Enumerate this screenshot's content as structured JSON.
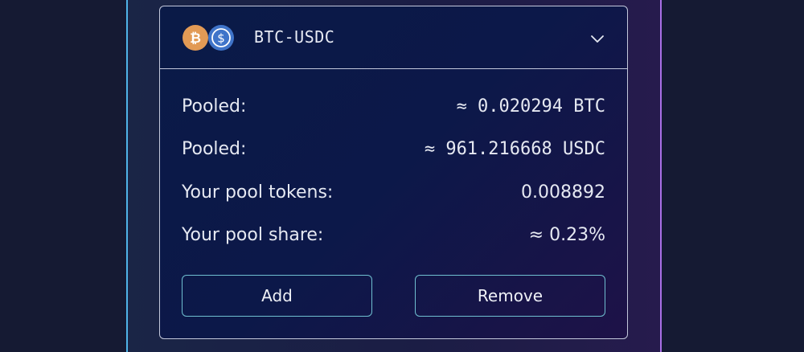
{
  "pool": {
    "pair": "BTC-USDC",
    "icons": {
      "token_a": "bitcoin-icon",
      "token_b": "usdc-icon",
      "expand": "chevron-down-icon"
    },
    "rows": [
      {
        "label": "Pooled:",
        "value": "≈ 0.020294 BTC"
      },
      {
        "label": "Pooled:",
        "value": "≈ 961.216668 USDC"
      },
      {
        "label": "Your pool tokens:",
        "value": "0.008892"
      },
      {
        "label": "Your pool share:",
        "value": "≈ 0.23%"
      }
    ],
    "buttons": {
      "add_label": "Add",
      "remove_label": "Remove"
    }
  },
  "colors": {
    "btc": "#e29a55",
    "usdc": "#3f74c9",
    "button_border": "#6fbfd0",
    "card_border": "#c3c8dc"
  }
}
